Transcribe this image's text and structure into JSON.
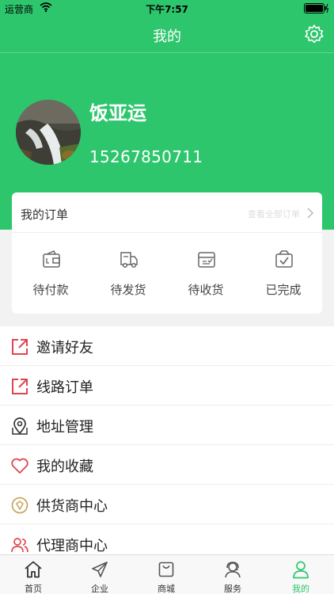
{
  "status_bar": {
    "carrier": "运营商",
    "time": "下午7:57"
  },
  "header": {
    "title": "我的"
  },
  "profile": {
    "name": "饭亚运",
    "phone": "15267850711"
  },
  "orders": {
    "title": "我的订单",
    "view_all": "查看全部订单",
    "items": [
      {
        "label": "待付款",
        "icon": "wallet-icon"
      },
      {
        "label": "待发货",
        "icon": "truck-icon"
      },
      {
        "label": "待收货",
        "icon": "inbox-icon"
      },
      {
        "label": "已完成",
        "icon": "check-box-icon"
      }
    ]
  },
  "menu": {
    "items": [
      {
        "label": "邀请好友",
        "icon": "share-icon"
      },
      {
        "label": "线路订单",
        "icon": "share-icon"
      },
      {
        "label": "地址管理",
        "icon": "map-pin-icon"
      },
      {
        "label": "我的收藏",
        "icon": "heart-icon"
      },
      {
        "label": "供货商中心",
        "icon": "badge-icon"
      },
      {
        "label": "代理商中心",
        "icon": "people-icon"
      }
    ]
  },
  "tabs": [
    {
      "label": "首页",
      "icon": "home-icon"
    },
    {
      "label": "企业",
      "icon": "send-icon"
    },
    {
      "label": "商城",
      "icon": "bag-icon"
    },
    {
      "label": "服务",
      "icon": "headset-icon"
    },
    {
      "label": "我的",
      "icon": "person-icon",
      "active": true
    }
  ],
  "colors": {
    "brand": "#2ec66d",
    "menu_icon_red": "#e0454f",
    "background": "#f2f2f2"
  }
}
